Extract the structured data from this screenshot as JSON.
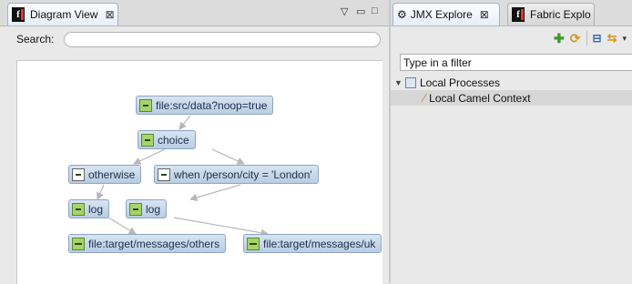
{
  "diagram_view": {
    "tab_title": "Diagram View",
    "search_label": "Search:",
    "search_value": "",
    "nodes": {
      "from": "file:src/data?noop=true",
      "choice": "choice",
      "otherwise": "otherwise",
      "when": "when /person/city = 'London'",
      "log1": "log",
      "log2": "log",
      "to_others": "file:target/messages/others",
      "to_uk": "file:target/messages/uk"
    }
  },
  "jmx_explorer": {
    "tab_title": "JMX Explore",
    "filter_placeholder": "Type in a filter",
    "tree": {
      "local_processes": "Local Processes",
      "camel_context": "Local Camel Context"
    }
  },
  "fabric_explorer": {
    "tab_title": "Fabric Explo"
  },
  "icons": {
    "fuse_logo": "fuse-logo-icon",
    "add": "add-icon",
    "refresh": "refresh-icon",
    "collapse": "collapse-all-icon",
    "link": "link-with-editor-icon"
  }
}
